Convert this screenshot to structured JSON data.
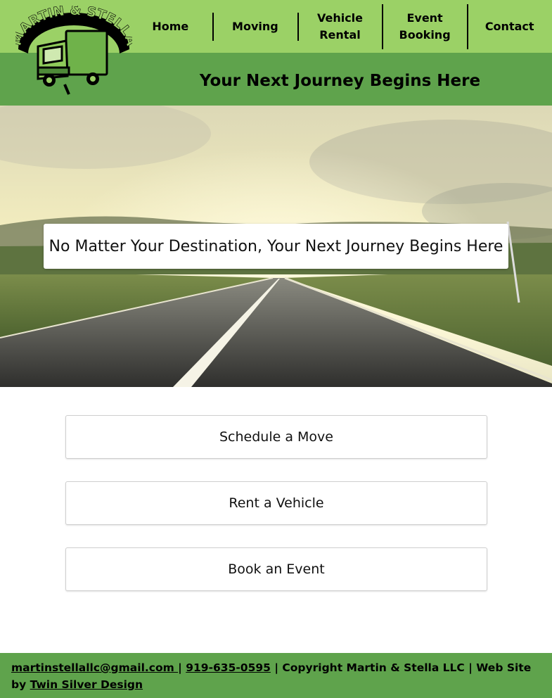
{
  "logo": {
    "text": "MARTIN & STELLA",
    "icon": "truck-icon"
  },
  "nav": {
    "items": [
      {
        "line1": "Home",
        "line2": ""
      },
      {
        "line1": "Moving",
        "line2": ""
      },
      {
        "line1": "Vehicle",
        "line2": "Rental"
      },
      {
        "line1": "Event",
        "line2": "Booking"
      },
      {
        "line1": "Contact",
        "line2": ""
      }
    ]
  },
  "banner": {
    "tagline": "Your Next Journey Begins Here"
  },
  "hero": {
    "caption": "No Matter Your Destination, Your Next Journey Begins Here"
  },
  "actions": [
    {
      "label": "Schedule a Move"
    },
    {
      "label": "Rent a Vehicle"
    },
    {
      "label": "Book an Event"
    }
  ],
  "footer": {
    "email": "martinstellallc@gmail.com ",
    "sep1": " | ",
    "phone": "919-635-0595",
    "copyright": " | Copyright Martin & Stella LLC | Web Site by ",
    "designer": "Twin Silver Design"
  },
  "colors": {
    "nav_green": "#9bd166",
    "banner_green": "#5fa34c",
    "footer_green": "#5fa34c"
  }
}
